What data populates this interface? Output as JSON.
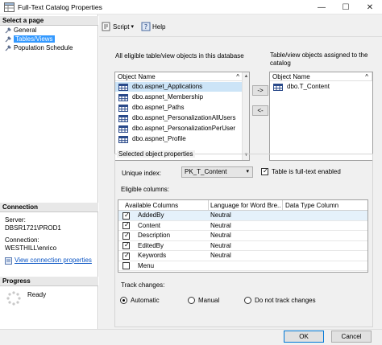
{
  "window": {
    "title": "Full-Text Catalog Properties",
    "minimize_glyph": "—",
    "maximize_glyph": "☐",
    "close_glyph": "✕"
  },
  "left_pane": {
    "select_page_header": "Select a page",
    "pages": [
      {
        "label": "General",
        "icon": "wrench-icon",
        "selected": false
      },
      {
        "label": "Tables/Views",
        "icon": "wrench-icon",
        "selected": true
      },
      {
        "label": "Population Schedule",
        "icon": "wrench-icon",
        "selected": false
      }
    ],
    "connection_header": "Connection",
    "server_label": "Server:",
    "server_value": "DBSR1721\\PROD1",
    "connection_label": "Connection:",
    "connection_value": "WESTHILL\\enrico",
    "view_connection_link": "View connection properties",
    "progress_header": "Progress",
    "progress_status": "Ready"
  },
  "toolbar": {
    "script_label": "Script",
    "script_dropdown_glyph": "▾",
    "help_label": "Help"
  },
  "eligible_objects": {
    "label": "All eligible table/view objects in this database",
    "column_header": "Object Name",
    "sort_glyph": "^",
    "items": [
      "dbo.aspnet_Applications",
      "dbo.aspnet_Membership",
      "dbo.aspnet_Paths",
      "dbo.aspnet_PersonalizationAllUsers",
      "dbo.aspnet_PersonalizationPerUser",
      "dbo.aspnet_Profile"
    ],
    "selected_index": 0
  },
  "transfer_buttons": {
    "add_label": "->",
    "remove_label": "<-"
  },
  "assigned_objects": {
    "label": "Table/view objects assigned to the catalog",
    "column_header": "Object Name",
    "sort_glyph": "^",
    "items": [
      "dbo.T_Content"
    ]
  },
  "selected_properties": {
    "group_label": "Selected object properties",
    "unique_index_label": "Unique index:",
    "unique_index_value": "PK_T_Content",
    "fulltext_enabled_label": "Table is full-text enabled",
    "fulltext_enabled": true,
    "eligible_columns_label": "Eligible columns:",
    "columns_headers": [
      "Available Columns",
      "Language for Word Bre...",
      "Data Type Column"
    ],
    "columns": [
      {
        "name": "AddedBy",
        "language": "Neutral",
        "checked": true
      },
      {
        "name": "Content",
        "language": "Neutral",
        "checked": true
      },
      {
        "name": "Description",
        "language": "Neutral",
        "checked": true
      },
      {
        "name": "EditedBy",
        "language": "Neutral",
        "checked": true
      },
      {
        "name": "Keywords",
        "language": "Neutral",
        "checked": true
      },
      {
        "name": "Menu",
        "language": "",
        "checked": false
      }
    ],
    "track_changes_label": "Track changes:",
    "track_options": [
      {
        "label": "Automatic",
        "checked": true
      },
      {
        "label": "Manual",
        "checked": false
      },
      {
        "label": "Do not track changes",
        "checked": false
      }
    ]
  },
  "footer": {
    "ok_label": "OK",
    "cancel_label": "Cancel"
  },
  "colors": {
    "accent": "#0078d7",
    "selection": "#3399ff",
    "link": "#0b55c4"
  }
}
